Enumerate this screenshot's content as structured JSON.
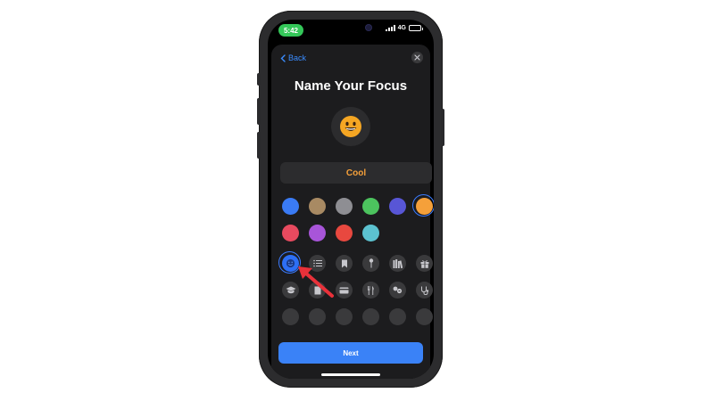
{
  "status_bar": {
    "time": "5:42",
    "network": "4G"
  },
  "nav": {
    "back_label": "Back",
    "close_icon": "close-icon"
  },
  "title": "Name Your Focus",
  "emoji": {
    "icon": "grinning-face-emoji",
    "color": "#f5a623"
  },
  "name_field": {
    "value": "Cool",
    "text_color": "#f5a03a"
  },
  "colors": {
    "options": [
      "#3a7bf5",
      "#a88a63",
      "#8e8e93",
      "#4cc35e",
      "#5856d6",
      "#f5a03a",
      "#e84a5f",
      "#a855d9",
      "#e8483f",
      "#5cc2d0"
    ],
    "selected": "#f5a03a"
  },
  "icons": {
    "row1": [
      "smiley-icon",
      "list-icon",
      "bookmark-icon",
      "pin-icon",
      "books-icon",
      "gift-icon"
    ],
    "row2": [
      "graduation-cap-icon",
      "document-icon",
      "credit-card-icon",
      "utensils-icon",
      "pills-icon",
      "stethoscope-icon"
    ],
    "selected": "smiley-icon"
  },
  "footer": {
    "next_label": "Next"
  },
  "annotation": {
    "arrow_color": "#e8313a"
  }
}
